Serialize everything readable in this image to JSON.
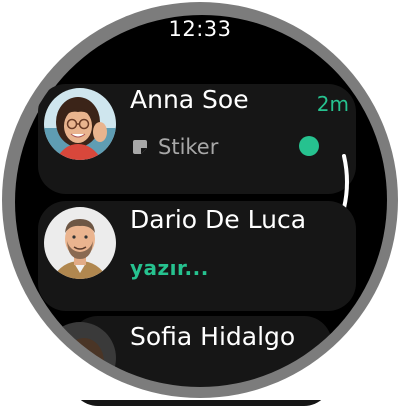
{
  "status": {
    "time": "12:33"
  },
  "conversations": [
    {
      "name": "Anna Soe",
      "time_ago": "2m",
      "preview": "Stiker",
      "preview_icon": "sticker-icon",
      "unread": true
    },
    {
      "name": "Dario De Luca",
      "status": "yazır..."
    },
    {
      "name": "Sofia Hidalgo"
    }
  ],
  "colors": {
    "accent": "#26c28f",
    "screen": "#000000",
    "card": "#161616",
    "muted_text": "#a8a8a8"
  }
}
